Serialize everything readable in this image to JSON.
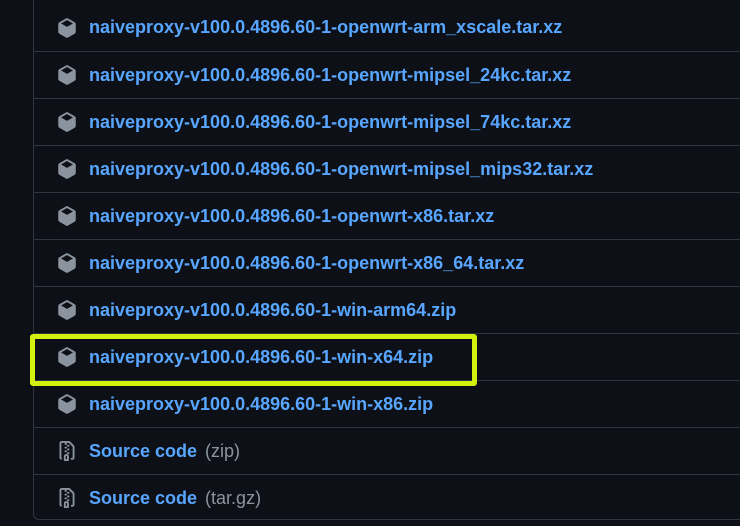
{
  "assets": [
    {
      "name": "naiveproxy-v100.0.4896.60-1-openwrt-arm_xscale.tar.xz",
      "icon": "package-icon"
    },
    {
      "name": "naiveproxy-v100.0.4896.60-1-openwrt-mipsel_24kc.tar.xz",
      "icon": "package-icon"
    },
    {
      "name": "naiveproxy-v100.0.4896.60-1-openwrt-mipsel_74kc.tar.xz",
      "icon": "package-icon"
    },
    {
      "name": "naiveproxy-v100.0.4896.60-1-openwrt-mipsel_mips32.tar.xz",
      "icon": "package-icon"
    },
    {
      "name": "naiveproxy-v100.0.4896.60-1-openwrt-x86.tar.xz",
      "icon": "package-icon"
    },
    {
      "name": "naiveproxy-v100.0.4896.60-1-openwrt-x86_64.tar.xz",
      "icon": "package-icon"
    },
    {
      "name": "naiveproxy-v100.0.4896.60-1-win-arm64.zip",
      "icon": "package-icon"
    },
    {
      "name": "naiveproxy-v100.0.4896.60-1-win-x64.zip",
      "icon": "package-icon"
    },
    {
      "name": "naiveproxy-v100.0.4896.60-1-win-x86.zip",
      "icon": "package-icon"
    }
  ],
  "source": [
    {
      "label": "Source code",
      "suffix": "(zip)",
      "icon": "file-zip-icon"
    },
    {
      "label": "Source code",
      "suffix": "(tar.gz)",
      "icon": "file-zip-icon"
    }
  ],
  "colors": {
    "background": "#0d1117",
    "link": "#58a6ff",
    "muted": "#8b949e",
    "border": "#30363d",
    "highlight": "#d4f00e"
  }
}
